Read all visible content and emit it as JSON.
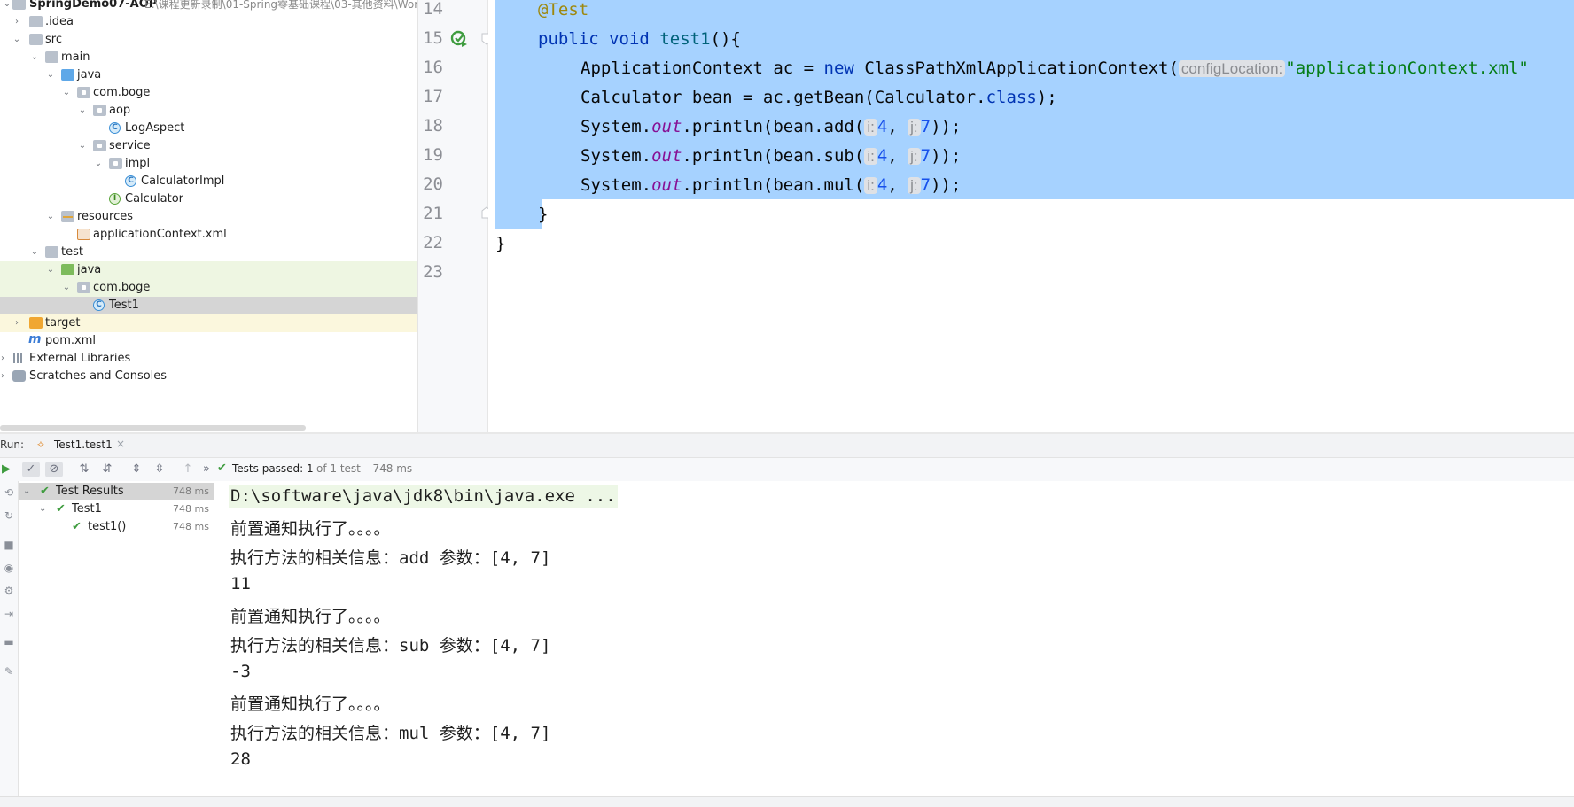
{
  "project": {
    "root": "SpringDemo07-AOP",
    "root_path": "E:\\课程更新录制\\01-Spring零基础课程\\03-其他资料\\Wor",
    "items": [
      {
        "label": ".idea"
      },
      {
        "label": "src"
      },
      {
        "label": "main"
      },
      {
        "label": "java"
      },
      {
        "label": "com.boge"
      },
      {
        "label": "aop"
      },
      {
        "label": "LogAspect"
      },
      {
        "label": "service"
      },
      {
        "label": "impl"
      },
      {
        "label": "CalculatorImpl"
      },
      {
        "label": "Calculator"
      },
      {
        "label": "resources"
      },
      {
        "label": "applicationContext.xml"
      },
      {
        "label": "test"
      },
      {
        "label": "java"
      },
      {
        "label": "com.boge"
      },
      {
        "label": "Test1"
      },
      {
        "label": "target"
      },
      {
        "label": "pom.xml"
      },
      {
        "label": "External Libraries"
      },
      {
        "label": "Scratches and Consoles"
      }
    ]
  },
  "editor": {
    "line_numbers": [
      "14",
      "15",
      "16",
      "17",
      "18",
      "19",
      "20",
      "21",
      "22",
      "23"
    ],
    "annotation": "@Test",
    "kw_public": "public",
    "kw_void": "void",
    "method_name": "test1",
    "method_tail": "(){",
    "l16_a": "ApplicationContext ac = ",
    "kw_new": "new",
    "l16_b": " ClassPathXmlApplicationContext(",
    "hint_config": "configLocation:",
    "l16_str": "\"applicationContext.xml\"",
    "l17_a": "Calculator bean = ac.getBean(Calculator.",
    "kw_class": "class",
    "l17_b": ");",
    "sys": "System.",
    "out": "out",
    "println_add": ".println(bean.add(",
    "println_sub": ".println(bean.sub(",
    "println_mul": ".println(bean.mul(",
    "hint_i": "i:",
    "hint_j": "j:",
    "arg_4": "4",
    "comma": ", ",
    "arg_7": "7",
    "close": "));",
    "brace_close": "}",
    "class_close": "}"
  },
  "run": {
    "label": "Run:",
    "tab": "Test1.test1",
    "tests_passed": "Tests passed: 1",
    "tests_summary": "of 1 test – 748 ms",
    "tree": [
      {
        "label": "Test Results",
        "time": "748 ms"
      },
      {
        "label": "Test1",
        "time": "748 ms"
      },
      {
        "label": "test1()",
        "time": "748 ms"
      }
    ]
  },
  "console": {
    "lines": [
      "D:\\software\\java\\jdk8\\bin\\java.exe ...",
      "前置通知执行了。。。。",
      "执行方法的相关信息：add 参数：[4, 7]",
      "11",
      "前置通知执行了。。。。",
      "执行方法的相关信息：sub 参数：[4, 7]",
      "-3",
      "前置通知执行了。。。。",
      "执行方法的相关信息：mul 参数：[4, 7]",
      "28"
    ]
  }
}
